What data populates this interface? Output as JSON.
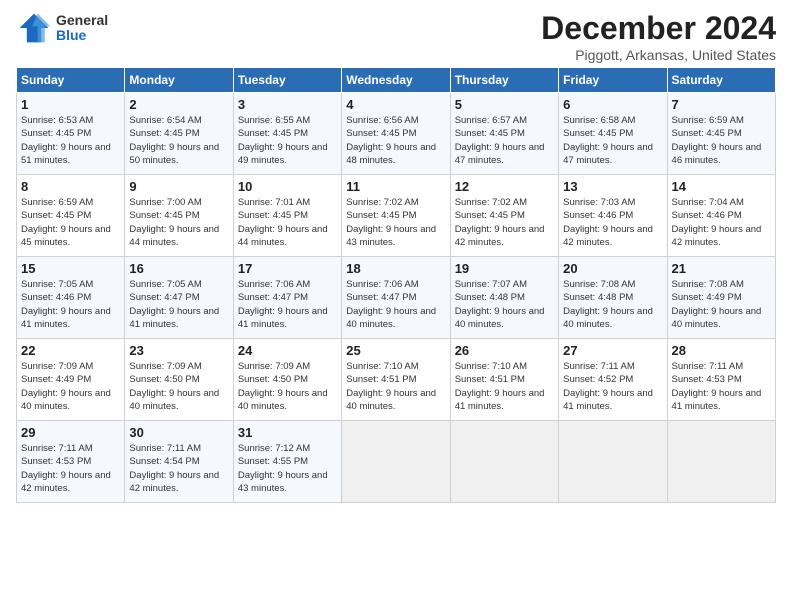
{
  "logo": {
    "general": "General",
    "blue": "Blue"
  },
  "header": {
    "title": "December 2024",
    "subtitle": "Piggott, Arkansas, United States"
  },
  "weekdays": [
    "Sunday",
    "Monday",
    "Tuesday",
    "Wednesday",
    "Thursday",
    "Friday",
    "Saturday"
  ],
  "weeks": [
    [
      {
        "day": "1",
        "info": "Sunrise: 6:53 AM\nSunset: 4:45 PM\nDaylight: 9 hours and 51 minutes."
      },
      {
        "day": "2",
        "info": "Sunrise: 6:54 AM\nSunset: 4:45 PM\nDaylight: 9 hours and 50 minutes."
      },
      {
        "day": "3",
        "info": "Sunrise: 6:55 AM\nSunset: 4:45 PM\nDaylight: 9 hours and 49 minutes."
      },
      {
        "day": "4",
        "info": "Sunrise: 6:56 AM\nSunset: 4:45 PM\nDaylight: 9 hours and 48 minutes."
      },
      {
        "day": "5",
        "info": "Sunrise: 6:57 AM\nSunset: 4:45 PM\nDaylight: 9 hours and 47 minutes."
      },
      {
        "day": "6",
        "info": "Sunrise: 6:58 AM\nSunset: 4:45 PM\nDaylight: 9 hours and 47 minutes."
      },
      {
        "day": "7",
        "info": "Sunrise: 6:59 AM\nSunset: 4:45 PM\nDaylight: 9 hours and 46 minutes."
      }
    ],
    [
      {
        "day": "8",
        "info": "Sunrise: 6:59 AM\nSunset: 4:45 PM\nDaylight: 9 hours and 45 minutes."
      },
      {
        "day": "9",
        "info": "Sunrise: 7:00 AM\nSunset: 4:45 PM\nDaylight: 9 hours and 44 minutes."
      },
      {
        "day": "10",
        "info": "Sunrise: 7:01 AM\nSunset: 4:45 PM\nDaylight: 9 hours and 44 minutes."
      },
      {
        "day": "11",
        "info": "Sunrise: 7:02 AM\nSunset: 4:45 PM\nDaylight: 9 hours and 43 minutes."
      },
      {
        "day": "12",
        "info": "Sunrise: 7:02 AM\nSunset: 4:45 PM\nDaylight: 9 hours and 42 minutes."
      },
      {
        "day": "13",
        "info": "Sunrise: 7:03 AM\nSunset: 4:46 PM\nDaylight: 9 hours and 42 minutes."
      },
      {
        "day": "14",
        "info": "Sunrise: 7:04 AM\nSunset: 4:46 PM\nDaylight: 9 hours and 42 minutes."
      }
    ],
    [
      {
        "day": "15",
        "info": "Sunrise: 7:05 AM\nSunset: 4:46 PM\nDaylight: 9 hours and 41 minutes."
      },
      {
        "day": "16",
        "info": "Sunrise: 7:05 AM\nSunset: 4:47 PM\nDaylight: 9 hours and 41 minutes."
      },
      {
        "day": "17",
        "info": "Sunrise: 7:06 AM\nSunset: 4:47 PM\nDaylight: 9 hours and 41 minutes."
      },
      {
        "day": "18",
        "info": "Sunrise: 7:06 AM\nSunset: 4:47 PM\nDaylight: 9 hours and 40 minutes."
      },
      {
        "day": "19",
        "info": "Sunrise: 7:07 AM\nSunset: 4:48 PM\nDaylight: 9 hours and 40 minutes."
      },
      {
        "day": "20",
        "info": "Sunrise: 7:08 AM\nSunset: 4:48 PM\nDaylight: 9 hours and 40 minutes."
      },
      {
        "day": "21",
        "info": "Sunrise: 7:08 AM\nSunset: 4:49 PM\nDaylight: 9 hours and 40 minutes."
      }
    ],
    [
      {
        "day": "22",
        "info": "Sunrise: 7:09 AM\nSunset: 4:49 PM\nDaylight: 9 hours and 40 minutes."
      },
      {
        "day": "23",
        "info": "Sunrise: 7:09 AM\nSunset: 4:50 PM\nDaylight: 9 hours and 40 minutes."
      },
      {
        "day": "24",
        "info": "Sunrise: 7:09 AM\nSunset: 4:50 PM\nDaylight: 9 hours and 40 minutes."
      },
      {
        "day": "25",
        "info": "Sunrise: 7:10 AM\nSunset: 4:51 PM\nDaylight: 9 hours and 40 minutes."
      },
      {
        "day": "26",
        "info": "Sunrise: 7:10 AM\nSunset: 4:51 PM\nDaylight: 9 hours and 41 minutes."
      },
      {
        "day": "27",
        "info": "Sunrise: 7:11 AM\nSunset: 4:52 PM\nDaylight: 9 hours and 41 minutes."
      },
      {
        "day": "28",
        "info": "Sunrise: 7:11 AM\nSunset: 4:53 PM\nDaylight: 9 hours and 41 minutes."
      }
    ],
    [
      {
        "day": "29",
        "info": "Sunrise: 7:11 AM\nSunset: 4:53 PM\nDaylight: 9 hours and 42 minutes."
      },
      {
        "day": "30",
        "info": "Sunrise: 7:11 AM\nSunset: 4:54 PM\nDaylight: 9 hours and 42 minutes."
      },
      {
        "day": "31",
        "info": "Sunrise: 7:12 AM\nSunset: 4:55 PM\nDaylight: 9 hours and 43 minutes."
      },
      null,
      null,
      null,
      null
    ]
  ]
}
